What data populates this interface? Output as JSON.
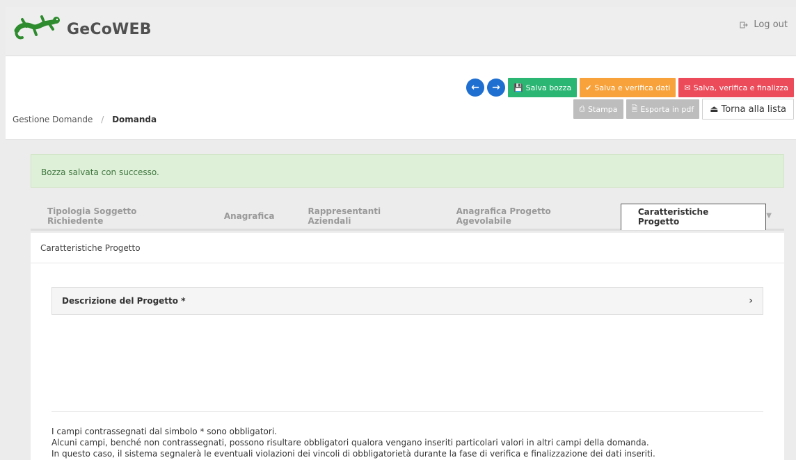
{
  "app": {
    "name": "GeCoWEB",
    "logout_label": "Log out"
  },
  "breadcrumb": {
    "parent": "Gestione Domande",
    "separator": "/",
    "current": "Domanda"
  },
  "toolbar": {
    "salva_bozza": "Salva bozza",
    "salva_verifica": "Salva e verifica dati",
    "salva_finalizza": "Salva, verifica e finalizza",
    "stampa": "Stampa",
    "esporta_pdf": "Esporta in pdf",
    "torna_lista": "Torna alla lista"
  },
  "alert": {
    "message": "Bozza salvata con successo."
  },
  "tabs": [
    {
      "label": "Tipologia Soggetto Richiedente"
    },
    {
      "label": "Anagrafica"
    },
    {
      "label": "Rappresentanti Aziendali"
    },
    {
      "label": "Anagrafica Progetto Agevolabile"
    },
    {
      "label": "Caratteristiche Progetto"
    }
  ],
  "panel": {
    "title": "Caratteristiche Progetto",
    "accordion_title": "Descrizione del Progetto *"
  },
  "notes": [
    "I campi contrassegnati dal simbolo * sono obbligatori.",
    "Alcuni campi, benché non contrassegnati, possono risultare obbligatori qualora vengano inseriti particolari valori in altri campi della domanda.",
    "In questo caso, il sistema segnalerà le eventuali violazioni dei vincoli di obbligatorietà durante la fase di verifica e finalizzazione dei dati inseriti."
  ],
  "colors": {
    "green": "#2bb673",
    "orange": "#f8a23b",
    "red": "#ec4b5a",
    "blue": "#1f6fd1",
    "logo_green": "#2e8b2e"
  }
}
